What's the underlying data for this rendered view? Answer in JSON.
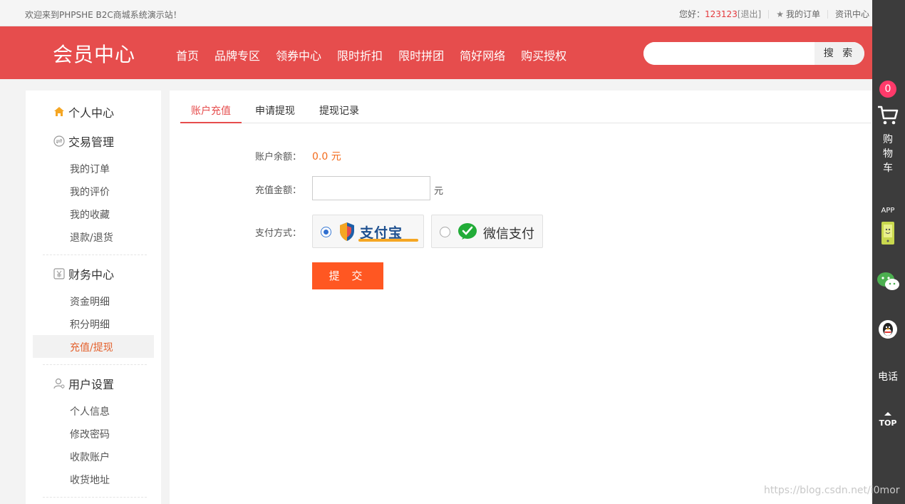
{
  "topbar": {
    "welcome": "欢迎来到PHPSHE B2C商城系统演示站！",
    "hello": "您好：",
    "username": "123123",
    "logout": "[退出]",
    "my_orders": "我的订单",
    "news": "资讯中心"
  },
  "header": {
    "title": "会员中心",
    "nav": [
      "首页",
      "品牌专区",
      "领券中心",
      "限时折扣",
      "限时拼团",
      "简好网络",
      "购买授权"
    ],
    "search_placeholder": "",
    "search_button": "搜 索"
  },
  "sidebar": {
    "personal": "个人中心",
    "trade": {
      "title": "交易管理",
      "items": [
        "我的订单",
        "我的评价",
        "我的收藏",
        "退款/退货"
      ]
    },
    "finance": {
      "title": "财务中心",
      "items": [
        "资金明细",
        "积分明细",
        "充值/提现"
      ],
      "active": "充值/提现"
    },
    "user": {
      "title": "用户设置",
      "items": [
        "个人信息",
        "修改密码",
        "收款账户",
        "收货地址"
      ]
    }
  },
  "tabs": [
    "账户充值",
    "申请提现",
    "提现记录"
  ],
  "form": {
    "balance_label": "账户余额：",
    "balance_value": "0.0 元",
    "amount_label": "充值金额：",
    "amount_value": "",
    "unit": "元",
    "pay_label": "支付方式：",
    "pay_options": [
      "支付宝",
      "微信支付"
    ],
    "selected_pay": "支付宝",
    "submit": "提 交"
  },
  "rightbar": {
    "cart_count": "0",
    "cart_label": "购物车",
    "app_label": "APP",
    "tel_label": "电话",
    "top_label": "TOP"
  },
  "watermark": "https://blog.csdn.net/i0mor",
  "colors": {
    "brand_red": "#e64d4d",
    "accent_orange": "#ff5722",
    "balance_orange": "#f36b1c",
    "sidebar_bg": "#3c3c3c"
  }
}
